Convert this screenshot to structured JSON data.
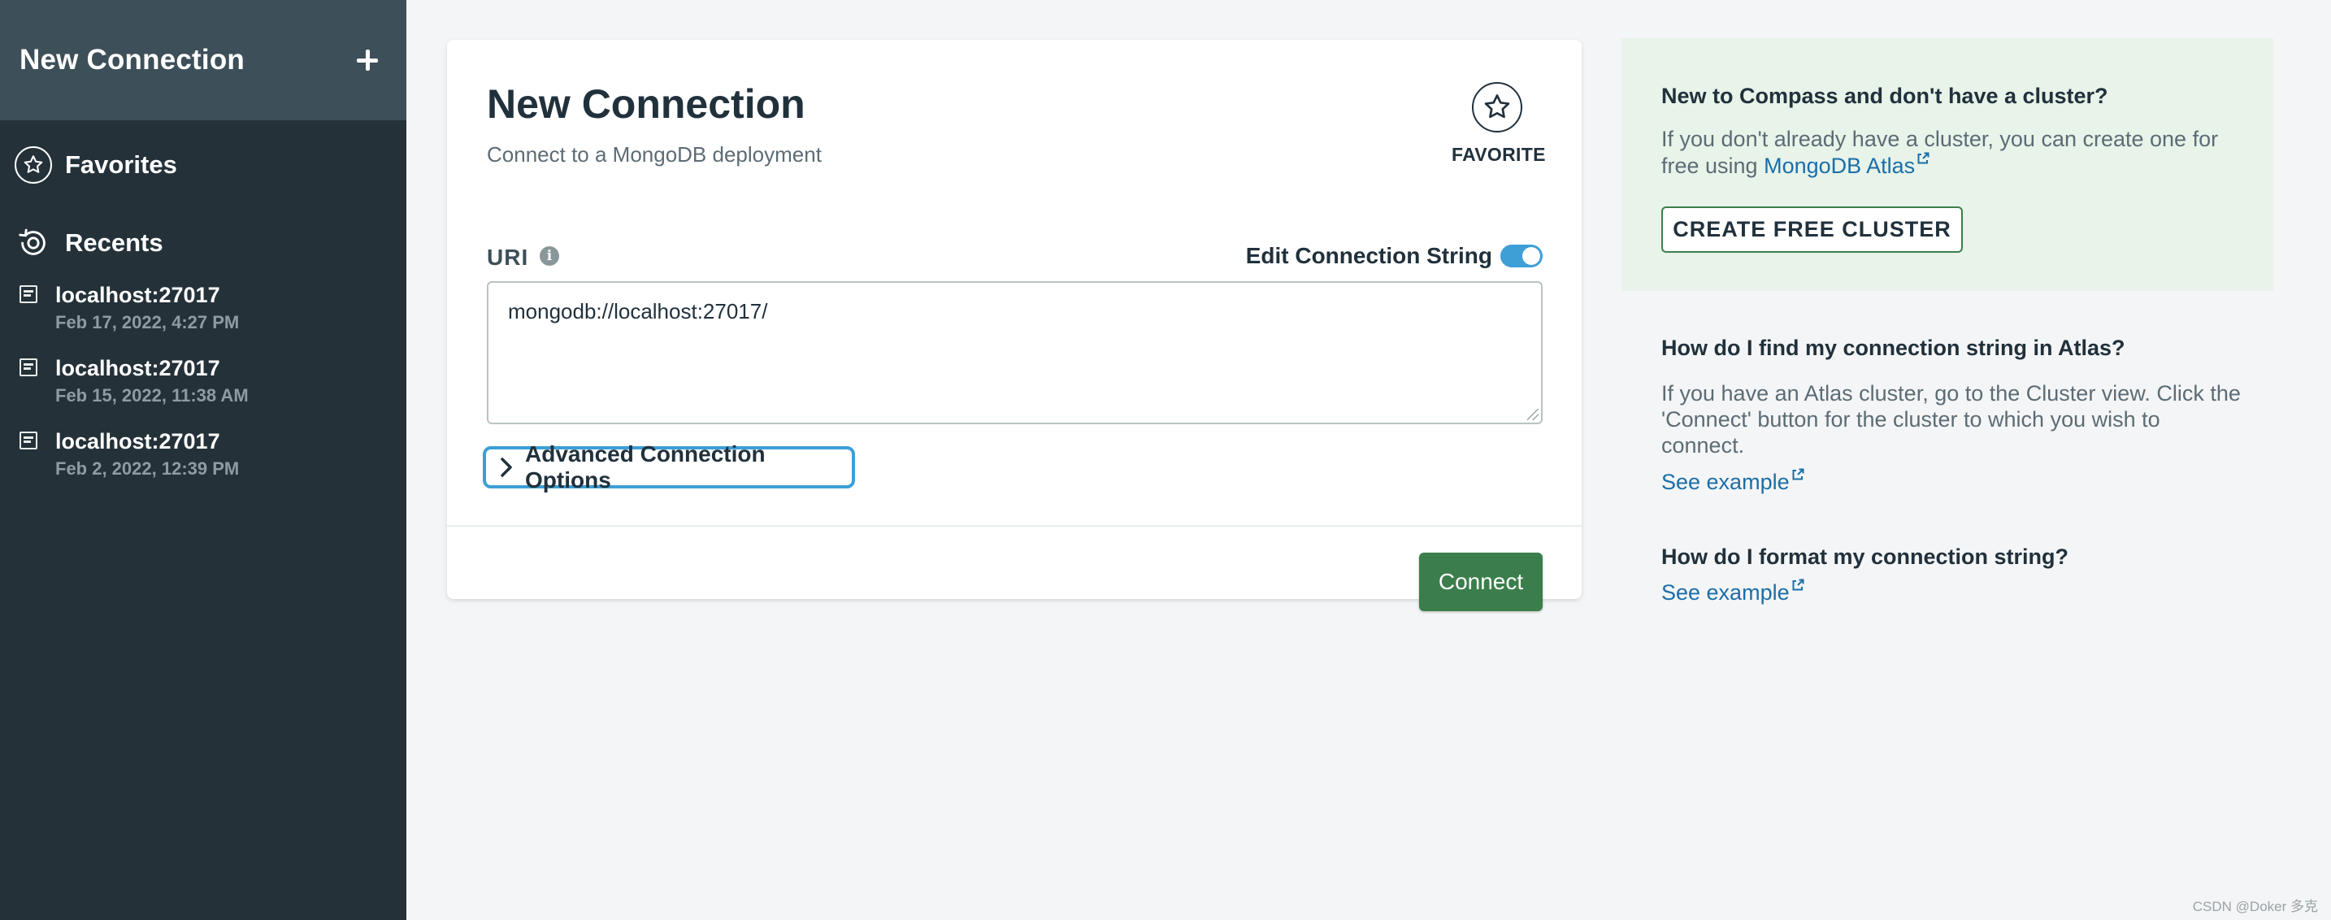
{
  "sidebar": {
    "title": "New Connection",
    "favorites_label": "Favorites",
    "recents_label": "Recents",
    "recents": [
      {
        "host": "localhost:27017",
        "date": "Feb 17, 2022, 4:27 PM"
      },
      {
        "host": "localhost:27017",
        "date": "Feb 15, 2022, 11:38 AM"
      },
      {
        "host": "localhost:27017",
        "date": "Feb 2, 2022, 12:39 PM"
      }
    ]
  },
  "card": {
    "title": "New Connection",
    "subtitle": "Connect to a MongoDB deployment",
    "favorite_label": "FAVORITE",
    "uri_label": "URI",
    "edit_cs_label": "Edit Connection String",
    "edit_cs_enabled": true,
    "uri_value": "mongodb://localhost:27017/",
    "advanced_label": "Advanced Connection Options",
    "connect_label": "Connect"
  },
  "help": {
    "cluster_title": "New to Compass and don't have a cluster?",
    "cluster_text": "If you don't already have a cluster, you can create one for free using ",
    "cluster_link": "MongoDB Atlas",
    "create_cluster_label": "CREATE FREE CLUSTER",
    "faq1_title": "How do I find my connection string in Atlas?",
    "faq1_text": "If you have an Atlas cluster, go to the Cluster view. Click the 'Connect' button for the cluster to which you wish to connect.",
    "faq1_link": "See example",
    "faq2_title": "How do I format my connection string?",
    "faq2_link": "See example"
  },
  "watermark": "CSDN @Doker 多克",
  "colors": {
    "sidebar_bg": "#243139",
    "sidebar_header_bg": "#3d4f58",
    "accent_green": "#3b7e4b",
    "focus_blue": "#3d9fd6",
    "link_blue": "#1a6ea8",
    "help_bg": "#e8f3e9"
  }
}
